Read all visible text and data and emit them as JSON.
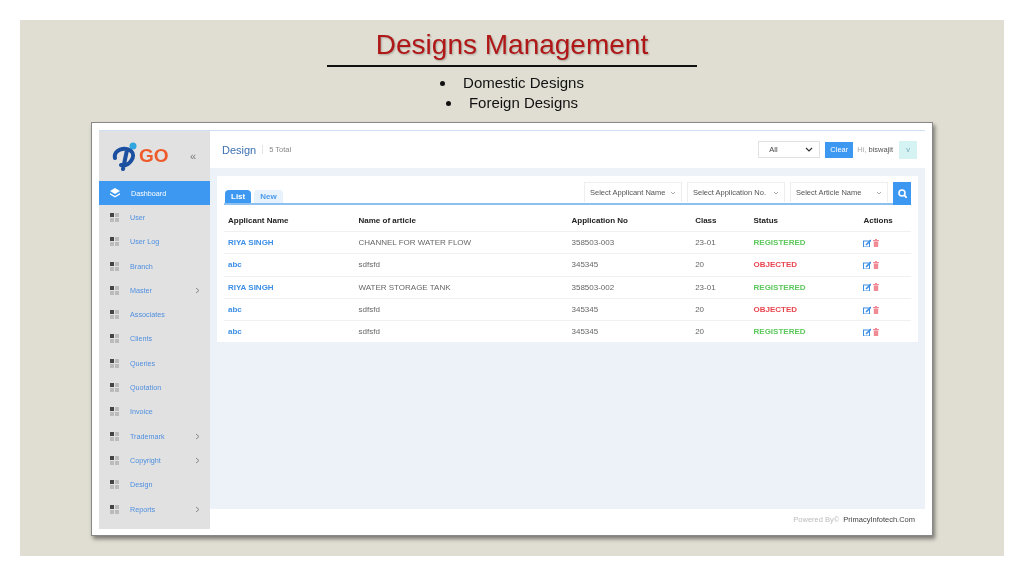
{
  "slide": {
    "title": "Designs Management",
    "bullets": [
      "Domestic Designs",
      "Foreign Designs"
    ]
  },
  "sidebar": {
    "logo_text": "GO",
    "collapse": "«",
    "items": [
      {
        "label": "Dashboard",
        "selected": true,
        "submenu": false,
        "kind": "layers"
      },
      {
        "label": "User",
        "selected": false,
        "submenu": false,
        "kind": "grid"
      },
      {
        "label": "User Log",
        "selected": false,
        "submenu": false,
        "kind": "grid"
      },
      {
        "label": "Branch",
        "selected": false,
        "submenu": false,
        "kind": "grid"
      },
      {
        "label": "Master",
        "selected": false,
        "submenu": true,
        "kind": "grid"
      },
      {
        "label": "Associates",
        "selected": false,
        "submenu": false,
        "kind": "grid"
      },
      {
        "label": "Clients",
        "selected": false,
        "submenu": false,
        "kind": "grid"
      },
      {
        "label": "Queries",
        "selected": false,
        "submenu": false,
        "kind": "grid"
      },
      {
        "label": "Quotation",
        "selected": false,
        "submenu": false,
        "kind": "grid"
      },
      {
        "label": "Invoice",
        "selected": false,
        "submenu": false,
        "kind": "grid"
      },
      {
        "label": "Trademark",
        "selected": false,
        "submenu": true,
        "kind": "grid"
      },
      {
        "label": "Copyright",
        "selected": false,
        "submenu": true,
        "kind": "grid"
      },
      {
        "label": "Design",
        "selected": false,
        "submenu": false,
        "kind": "grid"
      },
      {
        "label": "Reports",
        "selected": false,
        "submenu": true,
        "kind": "grid"
      }
    ]
  },
  "header": {
    "title": "Design",
    "count": "5 Total",
    "filter_value": "All",
    "clear_button": "Clear",
    "greeting": "Hi,",
    "user": "biswajit",
    "avatar": "v"
  },
  "tabs": [
    {
      "label": "List",
      "selected": true
    },
    {
      "label": "New",
      "selected": false
    }
  ],
  "filters": [
    {
      "placeholder": "Select Applicant Name"
    },
    {
      "placeholder": "Select Application No."
    },
    {
      "placeholder": "Select Article Name"
    }
  ],
  "table": {
    "columns": [
      "Applicant Name",
      "Name of article",
      "Application No",
      "Class",
      "Status",
      "Actions"
    ],
    "rows": [
      {
        "applicant": "RIYA SINGH",
        "article": "CHANNEL FOR WATER FLOW",
        "application_no": "358503-003",
        "class": "23-01",
        "status": "REGISTERED",
        "color": "#5cc85c"
      },
      {
        "applicant": "abc",
        "article": "sdfsfd",
        "application_no": "345345",
        "class": "20",
        "status": "OBJECTED",
        "color": "#e8474f"
      },
      {
        "applicant": "RIYA SINGH",
        "article": "WATER STORAGE TANK",
        "application_no": "358503-002",
        "class": "23-01",
        "status": "REGISTERED",
        "color": "#5cc85c"
      },
      {
        "applicant": "abc",
        "article": "sdfsfd",
        "application_no": "345345",
        "class": "20",
        "status": "OBJECTED",
        "color": "#e8474f"
      },
      {
        "applicant": "abc",
        "article": "sdfsfd",
        "application_no": "345345",
        "class": "20",
        "status": "REGISTERED",
        "color": "#5cc85c"
      }
    ]
  },
  "footer": {
    "powered": "Powered By©",
    "company": "PrimacyInfotech.Com"
  }
}
